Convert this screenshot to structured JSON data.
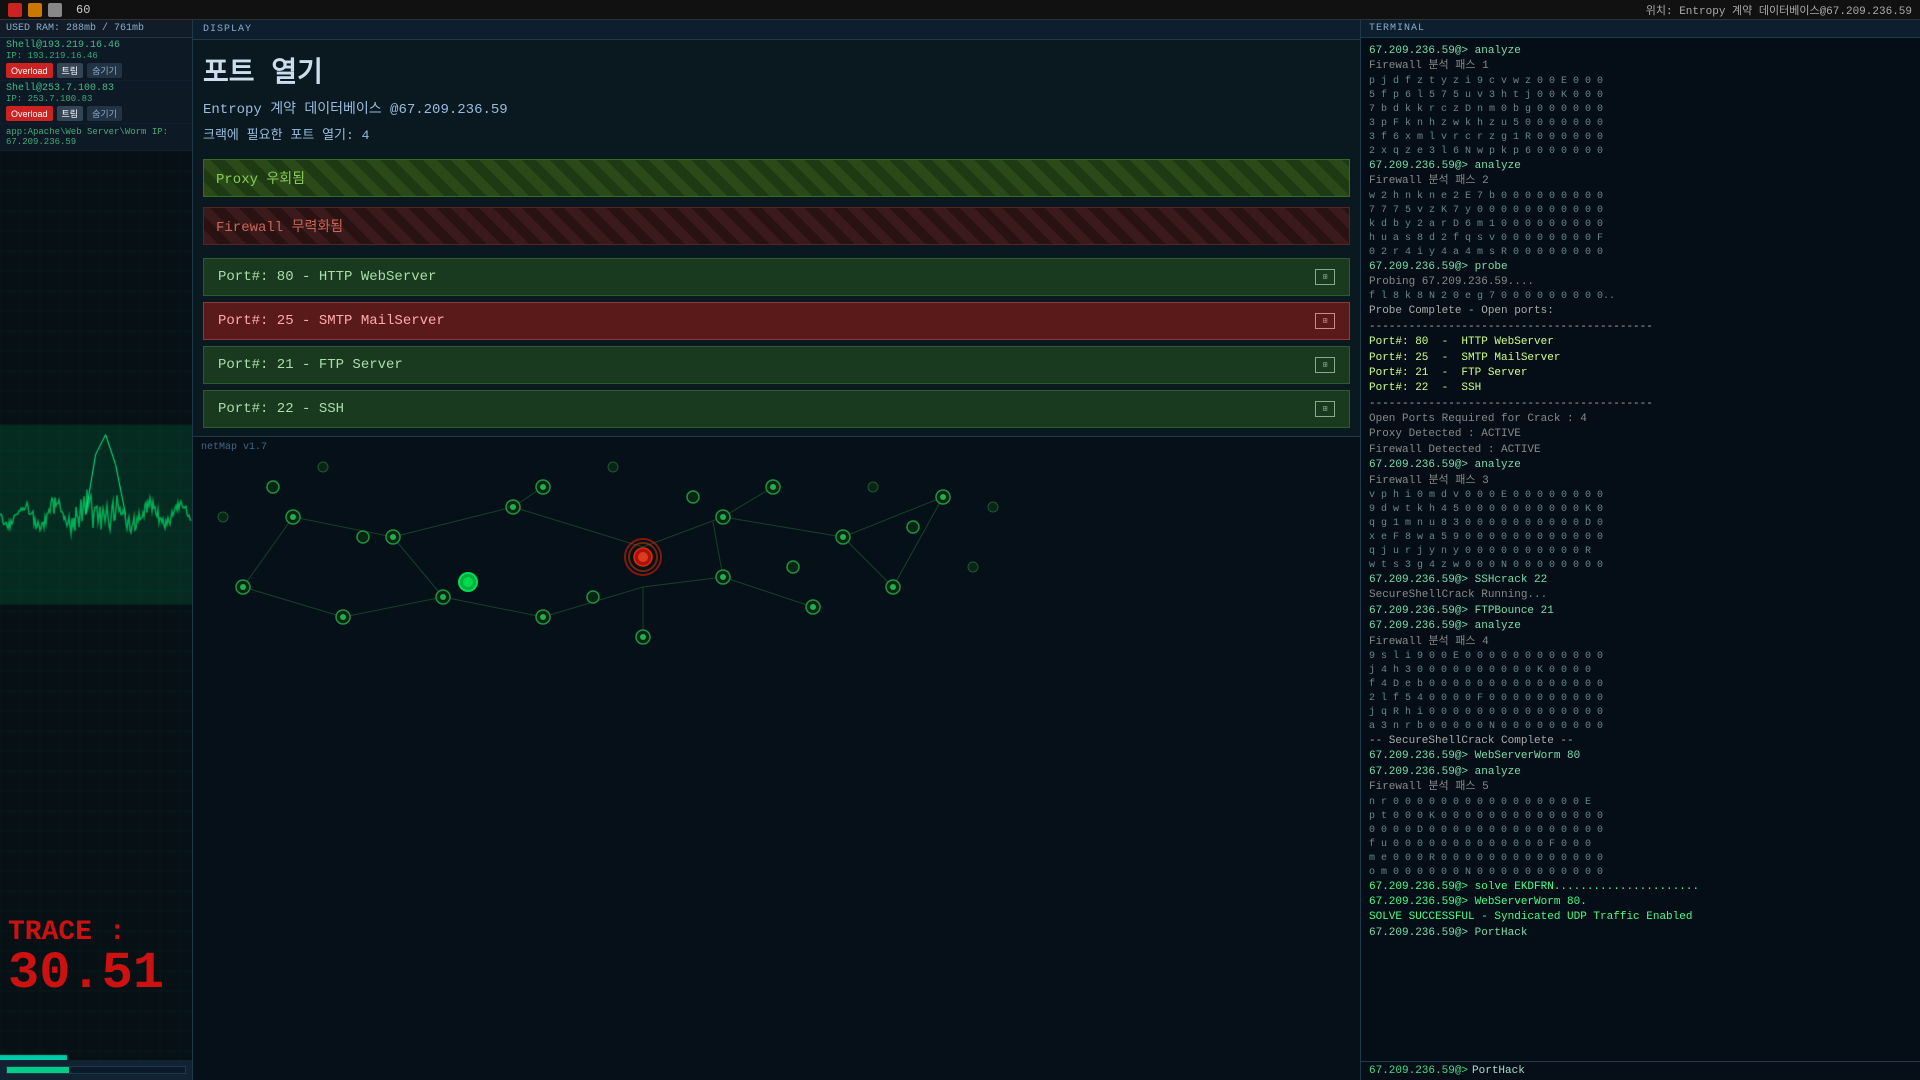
{
  "topbar": {
    "timer": "60",
    "location": "위치: Entropy 계약 데이터베이스@67.209.236.59"
  },
  "leftpanel": {
    "ram_label": "RAM",
    "ram_used": "USED RAM: 288mb / 761mb",
    "ram_count": "3",
    "connections": [
      {
        "name": "Shell@193.219.16.46",
        "ip": "IP: 193.219.16.46",
        "btn1": "Overload",
        "btn2": "트림",
        "btn3": "숨기기"
      },
      {
        "name": "Shell@253.7.100.83",
        "ip": "IP: 253.7.100.83",
        "btn1": "Overload",
        "btn2": "트림",
        "btn3": "숨기기"
      }
    ],
    "app_info": "app:Apache\\Web Server\\Worm IP: 67.209.236.59",
    "trace_label": "TRACE :",
    "trace_value": "30.51"
  },
  "display": {
    "header": "DISPLAY",
    "title": "포트 열기",
    "target": "Entropy 계약 데이터베이스 @67.209.236.59",
    "crack_ports": "크랙에 필요한 포트 열기: 4",
    "proxy_label": "Proxy 우회됨",
    "firewall_label": "Firewall 무력화됨",
    "ports": [
      {
        "number": "80",
        "service": "HTTP WebServer",
        "selected": false
      },
      {
        "number": "25",
        "service": "SMTP MailServer",
        "selected": true
      },
      {
        "number": "21",
        "service": "FTP Server",
        "selected": false
      },
      {
        "number": "22",
        "service": "SSH",
        "selected": false
      }
    ],
    "collapse_btn": "◄",
    "netmap_label": "netMap v1.7"
  },
  "terminal": {
    "header": "TERMINAL",
    "location_line": "위치: Entropy 계약 데이터베이스@67.209.236.59",
    "lines": [
      {
        "type": "cmd",
        "text": "67.209.236.59@> analyze"
      },
      {
        "type": "info",
        "text": "Firewall 분석 패스 1"
      },
      {
        "type": "data",
        "text": "p j d f z t y z i 9 c v w z 0 0 E 0 0 0"
      },
      {
        "type": "data",
        "text": "5 f p 6 l 5 7 5 u v 3 h t j 0 0 K 0 0 0"
      },
      {
        "type": "data",
        "text": "7 b d k k r c z D n m 0 b g 0 0 0 0 0 0"
      },
      {
        "type": "data",
        "text": "3 p F k n h z w k h z u 5 0 0 0 0 0 0 0"
      },
      {
        "type": "data",
        "text": "3 f 6 x m l v r c r z g 1 R 0 0 0 0 0 0"
      },
      {
        "type": "data",
        "text": "2 x q z e 3 l 6 N w p k p 6 0 0 0 0 0 0"
      },
      {
        "type": "cmd",
        "text": "67.209.236.59@> analyze"
      },
      {
        "type": "info",
        "text": "Firewall 분석 패스 2"
      },
      {
        "type": "data",
        "text": "w 2 h n k n e 2 E 7 b 0 0 0 0 0 0 0 0 0"
      },
      {
        "type": "data",
        "text": "7 7 7 5 v z K 7 y 0 0 0 0 0 0 0 0 0 0 0"
      },
      {
        "type": "data",
        "text": "k d b y 2 a r D 6 m 1 0 0 0 0 0 0 0 0 0"
      },
      {
        "type": "data",
        "text": "h u a s 8 d 2 f q s v 0 0 0 0 0 0 0 0 F"
      },
      {
        "type": "data",
        "text": "0 2 r 4 i y 4 a 4 m s R 0 0 0 0 0 0 0 0"
      },
      {
        "type": "cmd",
        "text": "67.209.236.59@> probe"
      },
      {
        "type": "info",
        "text": "Probing 67.209.236.59...."
      },
      {
        "type": "data",
        "text": "f l 8 k 8 N 2 0 e g 7 0 0 0 0 0 0 0 0 0.."
      },
      {
        "type": "heading",
        "text": "Probe Complete - Open ports:"
      },
      {
        "type": "heading",
        "text": "-------------------------------------------"
      },
      {
        "type": "highlight",
        "text": "Port#: 80  -  HTTP WebServer"
      },
      {
        "type": "highlight",
        "text": "Port#: 25  -  SMTP MailServer"
      },
      {
        "type": "highlight",
        "text": "Port#: 21  -  FTP Server"
      },
      {
        "type": "highlight",
        "text": "Port#: 22  -  SSH"
      },
      {
        "type": "heading",
        "text": "-------------------------------------------"
      },
      {
        "type": "info",
        "text": "Open Ports Required for Crack : 4"
      },
      {
        "type": "info",
        "text": "Proxy Detected : ACTIVE"
      },
      {
        "type": "info",
        "text": "Firewall Detected : ACTIVE"
      },
      {
        "type": "cmd",
        "text": "67.209.236.59@> analyze"
      },
      {
        "type": "info",
        "text": "Firewall 분석 패스 3"
      },
      {
        "type": "data",
        "text": "v p h i 0 m d v 0 0 0 E 0 0 0 0 0 0 0 0"
      },
      {
        "type": "data",
        "text": "9 d w t k h 4 5 0 0 0 0 0 0 0 0 0 0 K 0"
      },
      {
        "type": "data",
        "text": "q g 1 m n u 8 3 0 0 0 0 0 0 0 0 0 0 D 0"
      },
      {
        "type": "data",
        "text": "x e F 8 w a 5 9 0 0 0 0 0 0 0 0 0 0 0 0"
      },
      {
        "type": "data",
        "text": "q j u r j y n y 0 0 0 0 0 0 0 0 0 0 R"
      },
      {
        "type": "data",
        "text": "w t s 3 g 4 z w 0 0 0 N 0 0 0 0 0 0 0 0"
      },
      {
        "type": "cmd",
        "text": "67.209.236.59@> SSHcrack 22"
      },
      {
        "type": "info",
        "text": "SecureShellCrack Running..."
      },
      {
        "type": "cmd",
        "text": "67.209.236.59@> FTPBounce 21"
      },
      {
        "type": "cmd",
        "text": "67.209.236.59@> analyze"
      },
      {
        "type": "info",
        "text": "Firewall 분석 패스 4"
      },
      {
        "type": "data",
        "text": "9 s l i 9 0 0 E 0 0 0 0 0 0 0 0 0 0 0 0"
      },
      {
        "type": "data",
        "text": "j 4 h 3 0 0 0 0 0 0 0 0 0 0 K 0 0 0 0"
      },
      {
        "type": "data",
        "text": "f 4 D e b 0 0 0 0 0 0 0 0 0 0 0 0 0 0 0"
      },
      {
        "type": "data",
        "text": "2 l f 5 4 0 0 0 0 F 0 0 0 0 0 0 0 0 0 0"
      },
      {
        "type": "data",
        "text": "j q R h i 0 0 0 0 0 0 0 0 0 0 0 0 0 0 0"
      },
      {
        "type": "data",
        "text": "a 3 n r b 0 0 0 0 0 N 0 0 0 0 0 0 0 0 0"
      },
      {
        "type": "heading",
        "text": "-- SecureShellCrack Complete --"
      },
      {
        "type": "cmd",
        "text": "67.209.236.59@> WebServerWorm 80"
      },
      {
        "type": "cmd",
        "text": "67.209.236.59@> analyze"
      },
      {
        "type": "info",
        "text": "Firewall 분석 패스 5"
      },
      {
        "type": "data",
        "text": "n r 0 0 0 0 0 0 0 0 0 0 0 0 0 0 0 0 E"
      },
      {
        "type": "data",
        "text": "p t 0 0 0 K 0 0 0 0 0 0 0 0 0 0 0 0 0 0"
      },
      {
        "type": "data",
        "text": "0 0 0 0 D 0 0 0 0 0 0 0 0 0 0 0 0 0 0 0"
      },
      {
        "type": "data",
        "text": "f u 0 0 0 0 0 0 0 0 0 0 0 0 0 F 0 0 0"
      },
      {
        "type": "data",
        "text": "m e 0 0 0 R 0 0 0 0 0 0 0 0 0 0 0 0 0 0"
      },
      {
        "type": "data",
        "text": "o m 0 0 0 0 0 0 N 0 0 0 0 0 0 0 0 0 0 0"
      },
      {
        "type": "success",
        "text": "67.209.236.59@> solve EKDFRN......................"
      },
      {
        "type": "success",
        "text": "67.209.236.59@> WebServerWorm 80."
      },
      {
        "type": "success",
        "text": "SOLVE SUCCESSFUL - Syndicated UDP Traffic Enabled"
      },
      {
        "type": "cmd",
        "text": "67.209.236.59@> PortHack"
      }
    ],
    "input_prompt": "67.209.236.59@>",
    "input_value": "PortHack"
  }
}
